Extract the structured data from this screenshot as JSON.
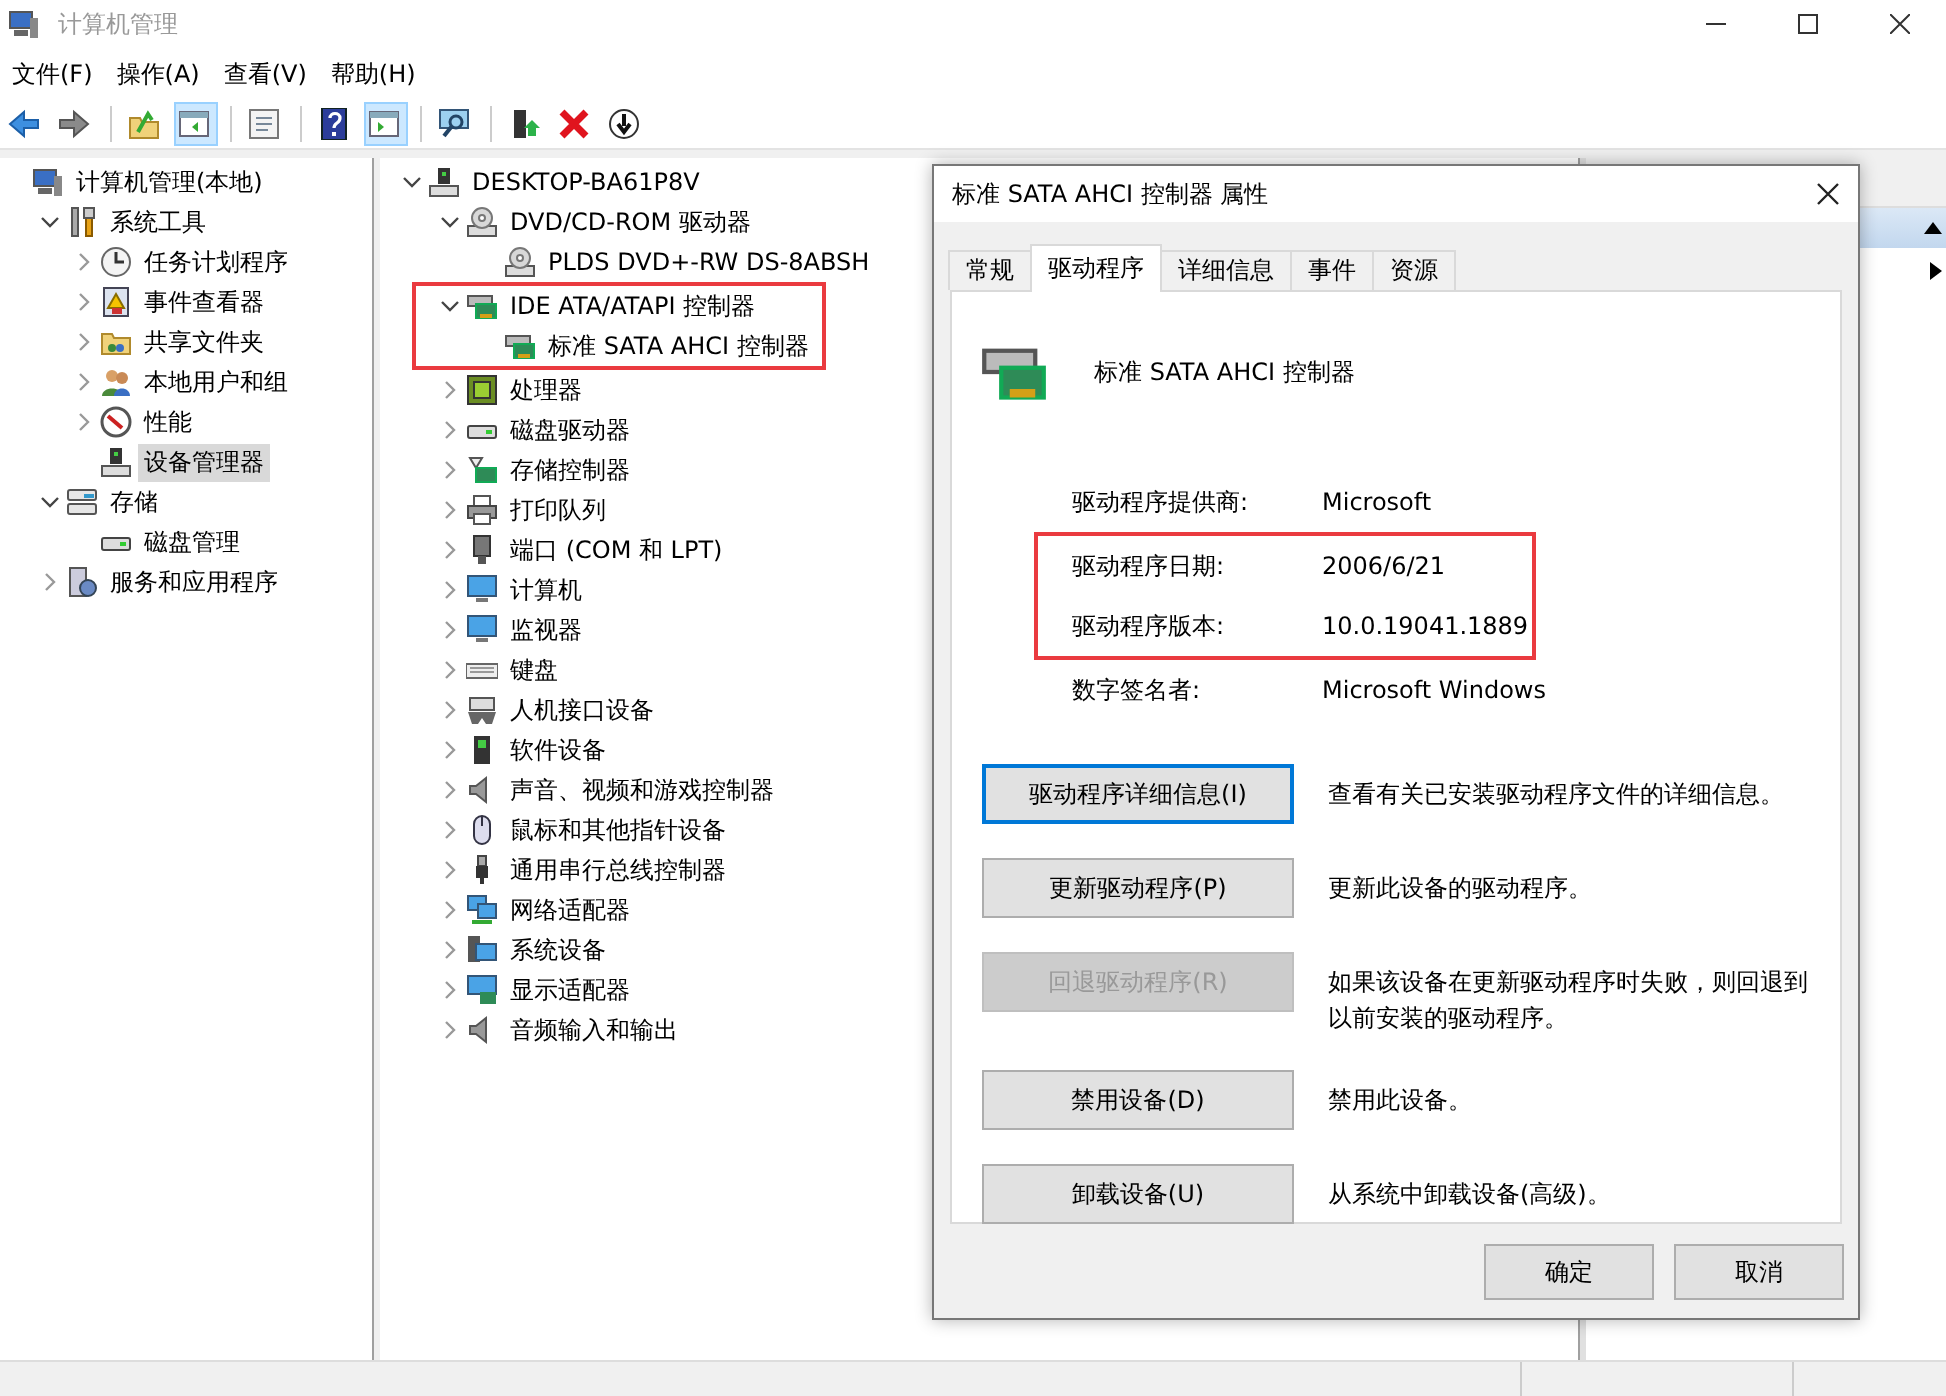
{
  "window": {
    "title": "计算机管理"
  },
  "menu": [
    "文件(F)",
    "操作(A)",
    "查看(V)",
    "帮助(H)"
  ],
  "toolbar": [
    {
      "kind": "back",
      "pressed": false
    },
    {
      "kind": "forward",
      "pressed": false
    },
    {
      "kind": "separator"
    },
    {
      "kind": "up",
      "pressed": false
    },
    {
      "kind": "tree-pane",
      "pressed": true
    },
    {
      "kind": "separator"
    },
    {
      "kind": "properties",
      "pressed": false
    },
    {
      "kind": "separator"
    },
    {
      "kind": "help",
      "pressed": false
    },
    {
      "kind": "action-pane",
      "pressed": true
    },
    {
      "kind": "separator"
    },
    {
      "kind": "scan",
      "pressed": false
    },
    {
      "kind": "separator"
    },
    {
      "kind": "enable",
      "pressed": false
    },
    {
      "kind": "delete",
      "pressed": false
    },
    {
      "kind": "update",
      "pressed": false
    }
  ],
  "nav_tree": [
    {
      "label": "计算机管理(本地)",
      "kind": "computer",
      "selected": false,
      "children": [
        {
          "label": "系统工具",
          "kind": "tools",
          "expanded": true,
          "selected": false,
          "children": [
            {
              "label": "任务计划程序",
              "kind": "clock",
              "expanded": false,
              "selected": false
            },
            {
              "label": "事件查看器",
              "kind": "log",
              "expanded": false,
              "selected": false
            },
            {
              "label": "共享文件夹",
              "kind": "folder",
              "expanded": false,
              "selected": false
            },
            {
              "label": "本地用户和组",
              "kind": "users",
              "expanded": false,
              "selected": false
            },
            {
              "label": "性能",
              "kind": "gauge",
              "expanded": false,
              "selected": false
            },
            {
              "label": "设备管理器",
              "kind": "device",
              "selected": true
            }
          ]
        },
        {
          "label": "存储",
          "kind": "storage",
          "expanded": true,
          "selected": false,
          "children": [
            {
              "label": "磁盘管理",
              "kind": "drive",
              "selected": false
            }
          ]
        },
        {
          "label": "服务和应用程序",
          "kind": "server",
          "expanded": false,
          "selected": false
        }
      ]
    }
  ],
  "device_tree": [
    {
      "label": "DESKTOP-BA61P8V",
      "kind": "device",
      "expanded": true,
      "highlighted": false,
      "children": [
        {
          "label": "DVD/CD-ROM 驱动器",
          "kind": "disc",
          "expanded": true,
          "highlighted": false,
          "children": [
            {
              "label": "PLDS DVD+-RW DS-8ABSH",
              "kind": "disc"
            }
          ]
        },
        {
          "label": "IDE ATA/ATAPI 控制器",
          "kind": "card",
          "expanded": true,
          "highlighted": true,
          "children": [
            {
              "label": "标准 SATA AHCI 控制器",
              "kind": "card"
            }
          ]
        },
        {
          "label": "处理器",
          "kind": "chip",
          "expanded": false,
          "highlighted": false
        },
        {
          "label": "磁盘驱动器",
          "kind": "drive",
          "expanded": false,
          "highlighted": false
        },
        {
          "label": "存储控制器",
          "kind": "storage-card",
          "expanded": false,
          "highlighted": false
        },
        {
          "label": "打印队列",
          "kind": "printer",
          "expanded": false,
          "highlighted": false
        },
        {
          "label": "端口 (COM 和 LPT)",
          "kind": "port",
          "expanded": false,
          "highlighted": false
        },
        {
          "label": "计算机",
          "kind": "monitor",
          "expanded": false,
          "highlighted": false
        },
        {
          "label": "监视器",
          "kind": "monitor",
          "expanded": false,
          "highlighted": false
        },
        {
          "label": "键盘",
          "kind": "keyboard",
          "expanded": false,
          "highlighted": false
        },
        {
          "label": "人机接口设备",
          "kind": "gamepad",
          "expanded": false,
          "highlighted": false
        },
        {
          "label": "软件设备",
          "kind": "tower",
          "expanded": false,
          "highlighted": false
        },
        {
          "label": "声音、视频和游戏控制器",
          "kind": "speaker",
          "expanded": false,
          "highlighted": false
        },
        {
          "label": "鼠标和其他指针设备",
          "kind": "mouse",
          "expanded": false,
          "highlighted": false
        },
        {
          "label": "通用串行总线控制器",
          "kind": "plug",
          "expanded": false,
          "highlighted": false
        },
        {
          "label": "网络适配器",
          "kind": "network",
          "expanded": false,
          "highlighted": false
        },
        {
          "label": "系统设备",
          "kind": "system",
          "expanded": false,
          "highlighted": false
        },
        {
          "label": "显示适配器",
          "kind": "display-card",
          "expanded": false,
          "highlighted": false
        },
        {
          "label": "音频输入和输出",
          "kind": "speaker",
          "expanded": false,
          "highlighted": false
        }
      ]
    }
  ],
  "dialog": {
    "title": "标准 SATA AHCI 控制器 属性",
    "tabs": [
      {
        "label": "常规",
        "selected": false
      },
      {
        "label": "驱动程序",
        "selected": true
      },
      {
        "label": "详细信息",
        "selected": false
      },
      {
        "label": "事件",
        "selected": false
      },
      {
        "label": "资源",
        "selected": false
      }
    ],
    "device_name": "标准 SATA AHCI 控制器",
    "properties": [
      {
        "label": "驱动程序提供商:",
        "value": "Microsoft",
        "highlighted": false
      },
      {
        "label": "驱动程序日期:",
        "value": "2006/6/21",
        "highlighted": true
      },
      {
        "label": "驱动程序版本:",
        "value": "10.0.19041.1889",
        "highlighted": true
      },
      {
        "label": "数字签名者:",
        "value": "Microsoft Windows",
        "highlighted": false
      }
    ],
    "actions": [
      {
        "button": "驱动程序详细信息(I)",
        "description": "查看有关已安装驱动程序文件的详细信息。",
        "disabled": false,
        "focused": true
      },
      {
        "button": "更新驱动程序(P)",
        "description": "更新此设备的驱动程序。",
        "disabled": false,
        "focused": false
      },
      {
        "button": "回退驱动程序(R)",
        "description": "如果该设备在更新驱动程序时失败，则回退到以前安装的驱动程序。",
        "disabled": true,
        "focused": false
      },
      {
        "button": "禁用设备(D)",
        "description": "禁用此设备。",
        "disabled": false,
        "focused": false
      },
      {
        "button": "卸载设备(U)",
        "description": "从系统中卸载设备(高级)。",
        "disabled": false,
        "focused": false
      }
    ],
    "buttons": [
      "确定",
      "取消"
    ]
  }
}
